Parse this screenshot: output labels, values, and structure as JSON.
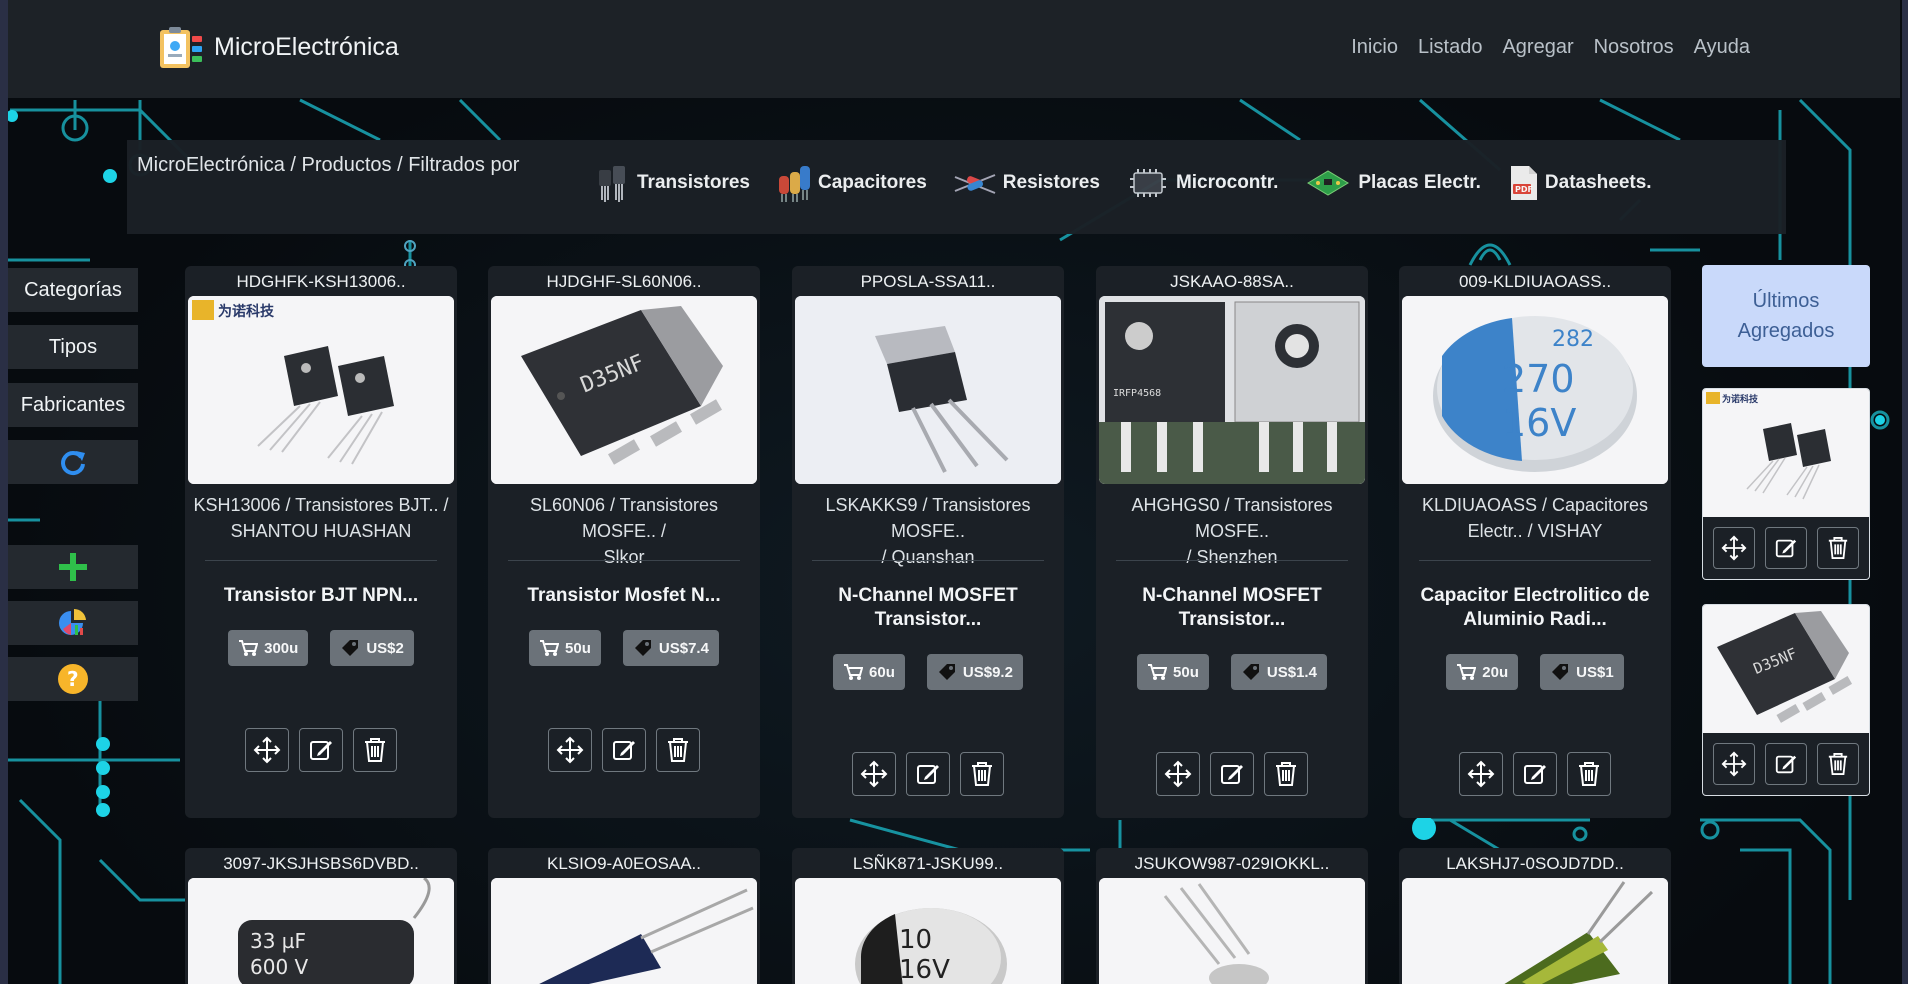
{
  "colors": {
    "accent_cyan": "#1dd3e6",
    "panel": "#1b2026",
    "badge": "#6b7279",
    "recent_bg": "#c9d9fa"
  },
  "header": {
    "brand": "MicroElectrónica",
    "nav": [
      "Inicio",
      "Listado",
      "Agregar",
      "Nosotros",
      "Ayuda"
    ]
  },
  "breadcrumb": "MicroElectrónica / Productos / Filtrados por",
  "categories": [
    "Transistores",
    "Capacitores",
    "Resistores",
    "Microcontr.",
    "Placas Electr.",
    "Datasheets."
  ],
  "sidebar": {
    "items": [
      "Categorías",
      "Tipos",
      "Fabricantes"
    ],
    "icons": [
      "refresh-icon",
      "add-icon",
      "pie-chart-icon",
      "help-icon"
    ]
  },
  "products": [
    {
      "code": "HDGHFK-KSH13006..",
      "meta1": "KSH13006 / Transistores BJT.. /",
      "meta2": "SHANTOU HUASHAN",
      "title1": "Transistor BJT NPN...",
      "title2": "",
      "stock": "300u",
      "price": "US$2"
    },
    {
      "code": "HJDGHF-SL60N06..",
      "meta1": "SL60N06 / Transistores MOSFE.. /",
      "meta2": "Slkor",
      "title1": "Transistor Mosfet N...",
      "title2": "",
      "stock": "50u",
      "price": "US$7.4"
    },
    {
      "code": "PPOSLA-SSA11..",
      "meta1": "LSKAKKS9 / Transistores MOSFE..",
      "meta2": "/ Quanshan",
      "title1": "N-Channel MOSFET",
      "title2": "Transistor...",
      "stock": "60u",
      "price": "US$9.2"
    },
    {
      "code": "JSKAAO-88SA..",
      "meta1": "AHGHGS0 / Transistores MOSFE..",
      "meta2": "/ Shenzhen",
      "title1": "N-Channel MOSFET",
      "title2": "Transistor...",
      "stock": "50u",
      "price": "US$1.4"
    },
    {
      "code": "009-KLDIUAOASS..",
      "meta1": "KLDIUAOASS / Capacitores",
      "meta2": "Electr.. / VISHAY",
      "title1": "Capacitor Electrolitico de",
      "title2": "Aluminio Radi...",
      "stock": "20u",
      "price": "US$1"
    }
  ],
  "products_row2": [
    "3097-JKSJHSBS6DVBD..",
    "KLSIO9-A0EOSAA..",
    "LSÑK871-JSKU99..",
    "JSUKOW987-029IOKKL..",
    "LAKSHJ7-0SOJD7DD.."
  ],
  "recent": {
    "title_line1": "Últimos",
    "title_line2": "Agregados"
  },
  "image_text": {
    "logo_cn": "为诺科技",
    "chip_d35nf": "D35NF",
    "cap_270": "270",
    "cap_16v": "16V",
    "cap_282": "282",
    "cap_33uf": "33 µF",
    "cap_600v": "600 V",
    "smd_10": "10",
    "smd_16v": "16V",
    "irf": "IRFP4568"
  }
}
